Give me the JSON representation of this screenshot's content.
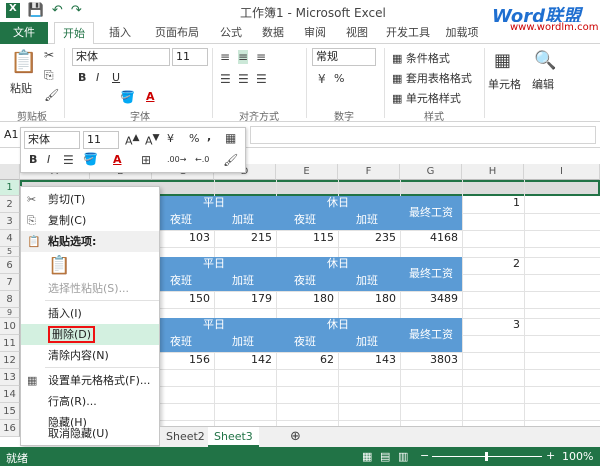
{
  "window": {
    "title": "工作簿1 - Microsoft Excel",
    "watermark": "Word联盟",
    "watermark_url": "www.wordlm.com"
  },
  "tabs": [
    "文件",
    "开始",
    "插入",
    "页面布局",
    "公式",
    "数据",
    "审阅",
    "视图",
    "开发工具",
    "加载项"
  ],
  "ribbon": {
    "paste": "粘贴",
    "clipboard": "剪贴板",
    "font_name": "宋体",
    "font_size": "11",
    "font_group": "字体",
    "align_group": "对齐方式",
    "number_format": "常规",
    "number_group": "数字",
    "cond_format": "条件格式",
    "table_format": "套用表格格式",
    "cell_style": "单元格样式",
    "styles_group": "样式",
    "cells_btn": "单元格",
    "edit_btn": "编辑",
    "pct": "%"
  },
  "mini_toolbar": {
    "font": "宋体",
    "size": "11",
    "bold": "B",
    "italic": "I",
    "pct": "%",
    "comma": ","
  },
  "name_box": "A1",
  "columns": [
    "A",
    "B",
    "C",
    "D",
    "E",
    "F",
    "G",
    "H",
    "I"
  ],
  "rows": [
    "1",
    "2",
    "3",
    "4",
    "5",
    "6",
    "7",
    "8",
    "9",
    "10",
    "11",
    "12",
    "13",
    "14",
    "15",
    "16"
  ],
  "table": {
    "weekday": "平日",
    "weekend": "休日",
    "overtime_off": "夜班",
    "overtime": "加班",
    "total": "最终工资",
    "blocks": [
      {
        "index": "1",
        "values": [
          "103",
          "215",
          "115",
          "235",
          "4168"
        ]
      },
      {
        "index": "2",
        "values": [
          "150",
          "179",
          "180",
          "180",
          "3489"
        ]
      },
      {
        "index": "3",
        "values": [
          "156",
          "142",
          "62",
          "143",
          "3803"
        ]
      }
    ]
  },
  "context_menu": {
    "cut": "剪切(T)",
    "copy": "复制(C)",
    "paste_options": "粘贴选项:",
    "paste_special": "选择性粘贴(S)...",
    "insert": "插入(I)",
    "delete": "删除(D)",
    "clear": "清除内容(N)",
    "format_cells": "设置单元格格式(F)...",
    "row_height": "行高(R)...",
    "hide": "隐藏(H)",
    "unhide": "取消隐藏(U)"
  },
  "sheets": [
    "Sheet2",
    "Sheet3"
  ],
  "status": {
    "ready": "就绪",
    "zoom": "100%"
  }
}
